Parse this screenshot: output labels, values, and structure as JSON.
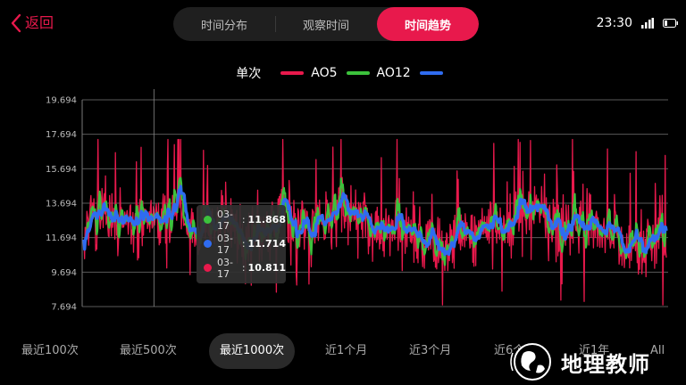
{
  "nav": {
    "back_label": "返回"
  },
  "tabs": [
    {
      "label": "时间分布",
      "active": false
    },
    {
      "label": "观察时间",
      "active": false
    },
    {
      "label": "时间趋势",
      "active": true
    }
  ],
  "status_bar": {
    "time": "23:30"
  },
  "legend": {
    "title": "单次",
    "items": [
      {
        "label": "AO5",
        "color": "#e8194c"
      },
      {
        "label": "AO12",
        "color": "#3cc23c"
      },
      {
        "label": "",
        "color": "#2f6cf0"
      }
    ]
  },
  "tooltip": {
    "rows": [
      {
        "date": "03-17",
        "value": "11.868",
        "color": "#3cc23c"
      },
      {
        "date": "03-17",
        "value": "11.714",
        "color": "#2f6cf0"
      },
      {
        "date": "03-17",
        "value": "10.811",
        "color": "#e8194c"
      }
    ]
  },
  "chart_data": {
    "type": "line",
    "y_ticks": [
      "19.694",
      "17.694",
      "15.694",
      "13.694",
      "11.694",
      "9.694",
      "7.694"
    ],
    "ylim": [
      7.694,
      19.694
    ],
    "n_points": 1000,
    "grid": true,
    "series": [
      {
        "name": "AO5",
        "color": "#e8194c"
      },
      {
        "name": "AO12",
        "color": "#3cc23c"
      }
    ],
    "tooltip_index": 120
  },
  "time_ranges": [
    {
      "label": "最近100次",
      "active": false
    },
    {
      "label": "最近500次",
      "active": false
    },
    {
      "label": "最近1000次",
      "active": true
    },
    {
      "label": "近1个月",
      "active": false
    },
    {
      "label": "近3个月",
      "active": false
    },
    {
      "label": "近6个月",
      "active": false
    },
    {
      "label": "近1年",
      "active": false
    },
    {
      "label": "All",
      "active": false
    }
  ],
  "watermark": {
    "text": "地理教师"
  }
}
